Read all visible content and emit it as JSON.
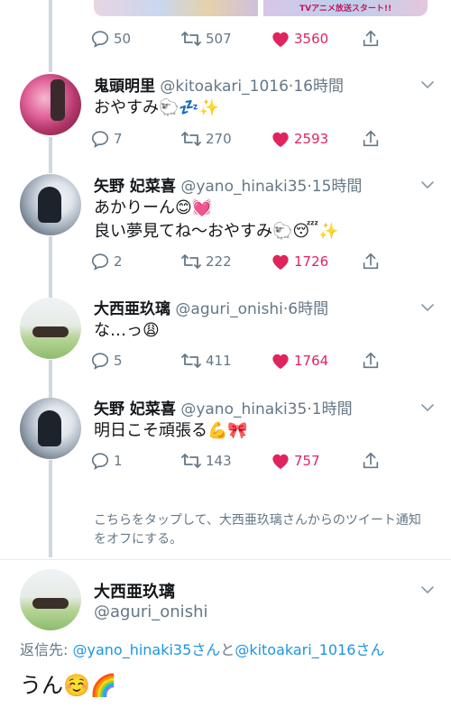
{
  "top_media": {
    "caption": "TVアニメ放送スタート!!"
  },
  "tweets": [
    {
      "actions": {
        "replies": "50",
        "retweets": "507",
        "likes": "3560"
      }
    },
    {
      "name": "鬼頭明里",
      "handle": "@kitoakari_1016",
      "sep": "·",
      "time": "16時間",
      "lines": [
        "おやすみ🐑💤✨"
      ],
      "actions": {
        "replies": "7",
        "retweets": "270",
        "likes": "2593"
      }
    },
    {
      "name": "矢野 妃菜喜",
      "handle": "@yano_hinaki35",
      "sep": "·",
      "time": "15時間",
      "lines": [
        "あかりーん😊💓",
        "良い夢見てね〜おやすみ🐑😴✨"
      ],
      "actions": {
        "replies": "2",
        "retweets": "222",
        "likes": "1726"
      }
    },
    {
      "name": "大西亜玖璃",
      "handle": "@aguri_onishi",
      "sep": "·",
      "time": "6時間",
      "lines": [
        "な…っ😩"
      ],
      "actions": {
        "replies": "5",
        "retweets": "411",
        "likes": "1764"
      }
    },
    {
      "name": "矢野 妃菜喜",
      "handle": "@yano_hinaki35",
      "sep": "·",
      "time": "1時間",
      "lines": [
        "明日こそ頑張る💪🎀"
      ],
      "actions": {
        "replies": "1",
        "retweets": "143",
        "likes": "757"
      }
    }
  ],
  "mute_notice": "こちらをタップして、大西亜玖璃さんからのツイート通知をオフにする。",
  "focused_tweet": {
    "name": "大西亜玖璃",
    "handle": "@aguri_onishi",
    "reply_prefix": "返信先: ",
    "reply_user1": "@yano_hinaki35さん",
    "reply_and": "と",
    "reply_user2": "@kitoakari_1016さん",
    "text": "うん☺️🌈"
  },
  "colors": {
    "like": "#e0245e",
    "link": "#1b95e0",
    "muted": "#657786",
    "thread_line": "#cfd9de"
  }
}
